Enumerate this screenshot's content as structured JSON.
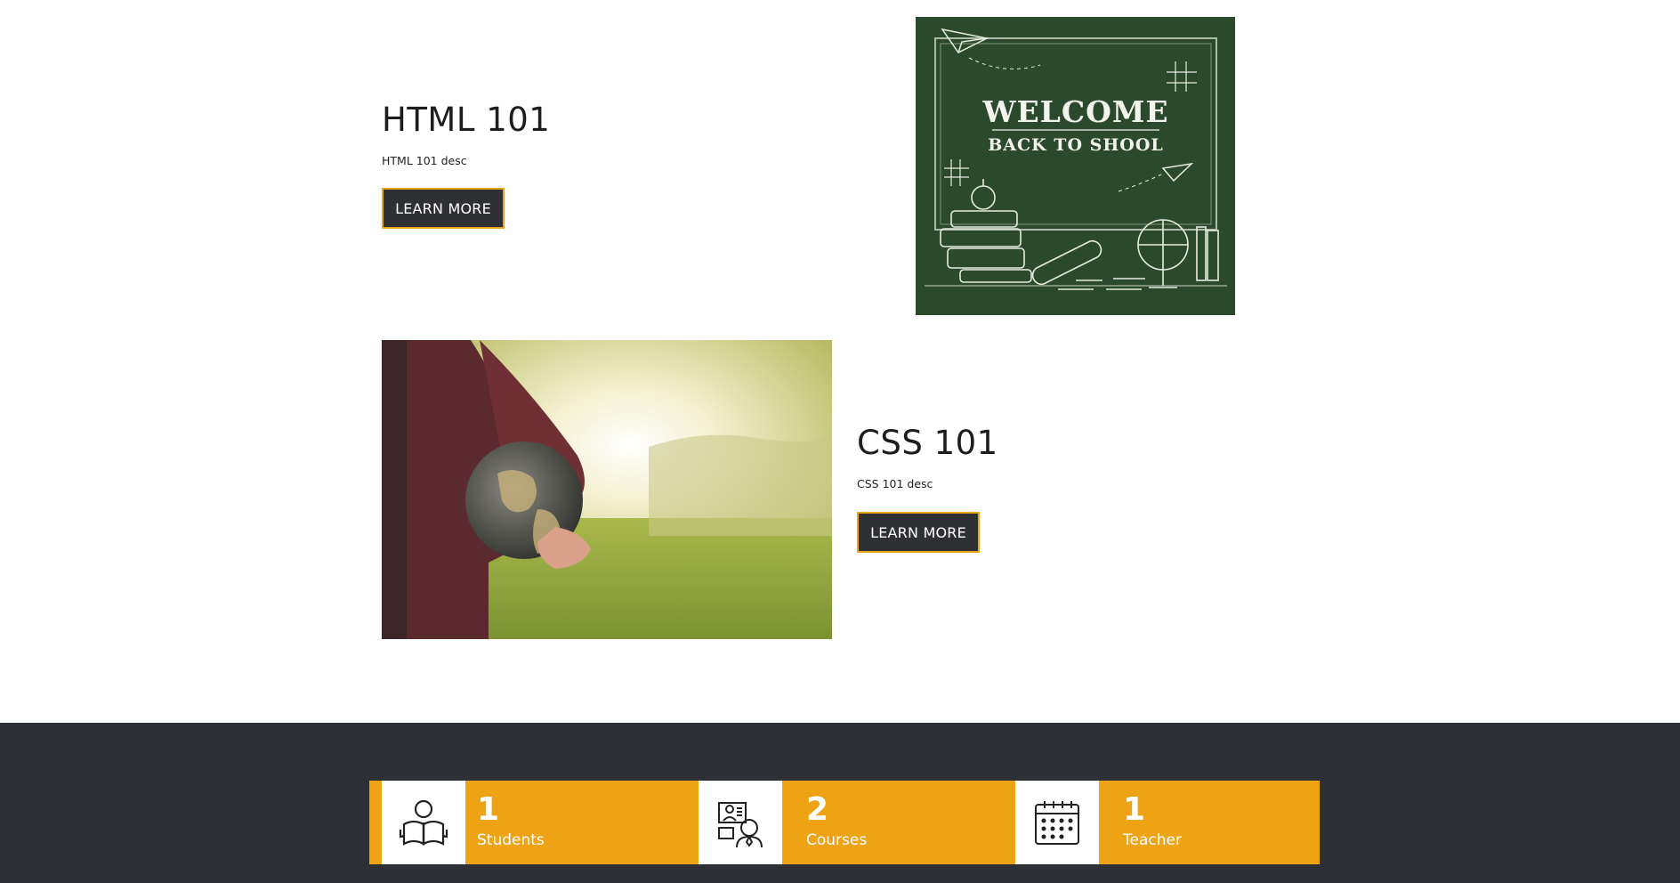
{
  "courses": [
    {
      "title": "HTML 101",
      "description": "HTML 101 desc",
      "button_label": "LEARN MORE",
      "image": {
        "heading": "WELCOME",
        "subheading": "BACK TO SHOOL"
      }
    },
    {
      "title": "CSS 101",
      "description": "CSS 101 desc",
      "button_label": "LEARN MORE"
    }
  ],
  "stats": [
    {
      "count": "1",
      "label": "Students",
      "icon": "student-reading-icon"
    },
    {
      "count": "2",
      "label": "Courses",
      "icon": "online-course-icon"
    },
    {
      "count": "1",
      "label": "Teacher",
      "icon": "calendar-icon"
    }
  ],
  "colors": {
    "accent": "#eea315",
    "dark": "#2d3034",
    "button_bg": "#2e3033",
    "chalkboard": "#2b4a2c"
  }
}
